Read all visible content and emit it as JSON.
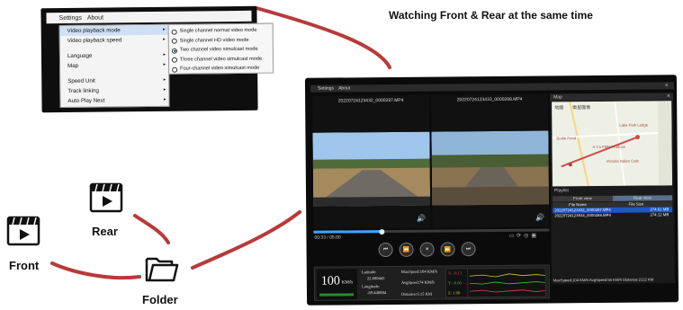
{
  "caption": "Watching Front & Rear at the same time",
  "menu": {
    "menubar": [
      "Settings",
      "About"
    ],
    "items": [
      {
        "label": "Video playback mode",
        "arrow": "▸",
        "selected": true
      },
      {
        "label": "Video playback speed",
        "arrow": "▸"
      },
      {
        "label": "Language",
        "arrow": "▸"
      },
      {
        "label": "Map",
        "arrow": "▸"
      },
      {
        "label": "Speed Unit",
        "arrow": "▸"
      },
      {
        "label": "Track linking",
        "arrow": "▸"
      },
      {
        "label": "Auto Play Next",
        "arrow": "▸"
      }
    ],
    "submenu": [
      {
        "label": "Single channel normal video mode",
        "checked": false
      },
      {
        "label": "Single channel HD video mode",
        "checked": false
      },
      {
        "label": "Two channel video simulcast mode",
        "checked": true
      },
      {
        "label": "Three channel video simulcast mode",
        "checked": false
      },
      {
        "label": "Four-channel video simulcast mode",
        "checked": false
      }
    ]
  },
  "labels": {
    "front": "Front",
    "rear": "Rear",
    "folder": "Folder"
  },
  "icons": {
    "front": "video-file-icon",
    "rear": "video-file-icon",
    "folder": "folder-icon"
  },
  "player": {
    "menubar": [
      "Settings",
      "About"
    ],
    "close": "✕",
    "front_file": "20220724123432_0000287.MP4",
    "rear_file": "20220724123433_0000288.MP4",
    "speaker": "🔊",
    "progress": 0.29,
    "time": "00:33 / 05:00",
    "tools": [
      "▭",
      "⟳",
      "◎",
      "▣"
    ],
    "controls": [
      "⏮",
      "⏪",
      "⏸",
      "⏩",
      "⏭"
    ],
    "dash": {
      "speed": "100",
      "unit": "KM/h",
      "latitude_label": "Latitude:",
      "latitude": "22.600443",
      "longitude_label": "Longitude:",
      "longitude": "-69.440084",
      "max_speed": "MaxSpeed:104 KM/h",
      "avg_speed": "AvgSpeed:74 KM/h",
      "distance": "Distance:0.15 KM",
      "g_values": [
        "X: -0.13",
        "Y: -0.06",
        "Z: 1.00"
      ]
    }
  },
  "map_panel": {
    "title": "Map",
    "close": "✕",
    "tabs": [
      "地圖",
      "衛星圖像"
    ],
    "places": [
      "Lake Park Lodge",
      "Bottle Pond",
      "A-1's FMR Produce",
      "Victoria Italian Cafe"
    ],
    "playlist_label": "Playlist",
    "playlist_tabs": [
      "Front view",
      "Rear view"
    ],
    "columns": [
      "File Name",
      "File Size"
    ],
    "rows": [
      {
        "name": "20220724123432_0000287.MP4",
        "size": "274.61 MB"
      },
      {
        "name": "20220724123934_0000288.MP4",
        "size": "274.12 MB"
      }
    ],
    "status": "MaxSpeed:104 KM/h  AvgSpeed:55 KM/h   Distance:2122 KM"
  },
  "colors": {
    "connector": "#b83a3a",
    "accent": "#3aa6ff",
    "route": "#d14a4a",
    "playlist_highlight": "#1f57c3"
  }
}
